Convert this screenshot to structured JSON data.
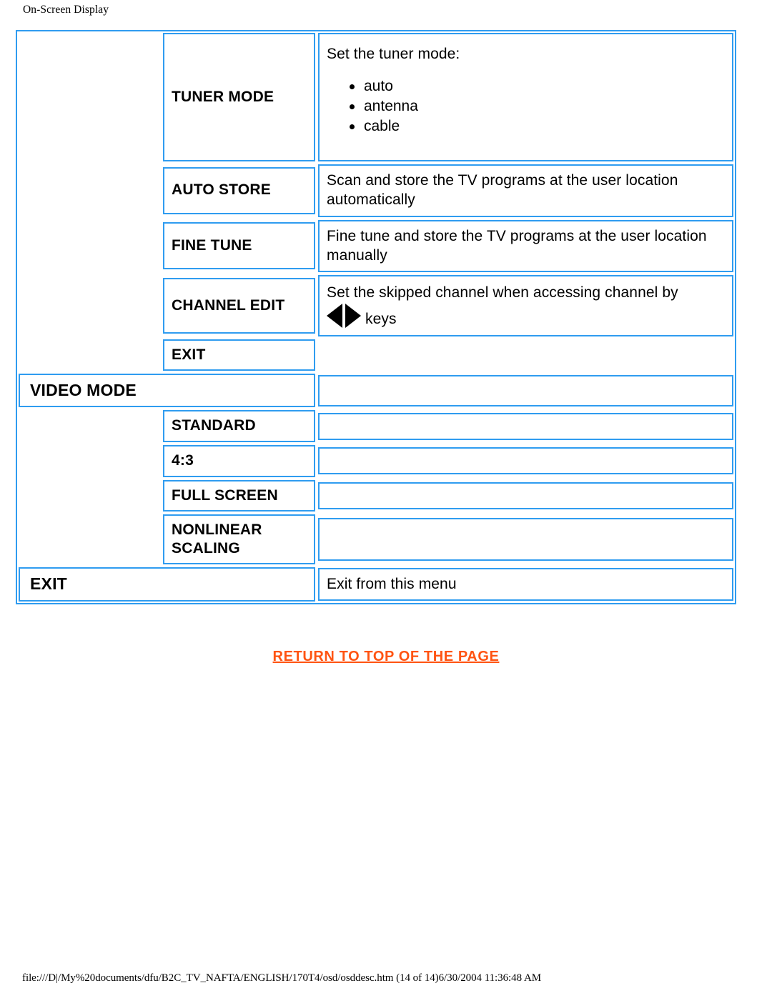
{
  "page": {
    "header": "On-Screen Display",
    "footer": "file:///D|/My%20documents/dfu/B2C_TV_NAFTA/ENGLISH/170T4/osd/osddesc.htm (14 of 14)6/30/2004 11:36:48 AM"
  },
  "colors": {
    "border_blue": "#2f9cf0",
    "link_orange": "#ff5412",
    "text_black": "#000000"
  },
  "table": {
    "rows": [
      {
        "id": "tuner-mode",
        "label": "TUNER MODE",
        "desc_intro": "Set the tuner mode:",
        "bullets": [
          "auto",
          "antenna",
          "cable"
        ]
      },
      {
        "id": "auto-store",
        "label": "AUTO STORE",
        "desc": "Scan and store the TV programs at the user location automatically"
      },
      {
        "id": "fine-tune",
        "label": "FINE TUNE",
        "desc": "Fine tune and store the TV programs at the user location manually"
      },
      {
        "id": "channel-edit",
        "label": "CHANNEL EDIT",
        "desc_before": "Set the skipped channel when accessing channel by",
        "desc_after": "keys",
        "icons": [
          "left-arrow-icon",
          "right-arrow-icon"
        ]
      },
      {
        "id": "exit-submenu",
        "label": "EXIT",
        "desc": ""
      },
      {
        "id": "video-mode",
        "label": "VIDEO MODE",
        "desc": ""
      },
      {
        "id": "standard",
        "label": "STANDARD",
        "desc": ""
      },
      {
        "id": "aspect-4-3",
        "label": "4:3",
        "desc": ""
      },
      {
        "id": "full-screen",
        "label": "FULL SCREEN",
        "desc": ""
      },
      {
        "id": "nonlinear-scaling",
        "label_line1": "NONLINEAR",
        "label_line2": "SCALING",
        "desc": ""
      },
      {
        "id": "exit-main",
        "label": "EXIT",
        "desc": "Exit from this menu"
      }
    ]
  },
  "return_link": {
    "label": "RETURN TO TOP OF THE PAGE"
  }
}
